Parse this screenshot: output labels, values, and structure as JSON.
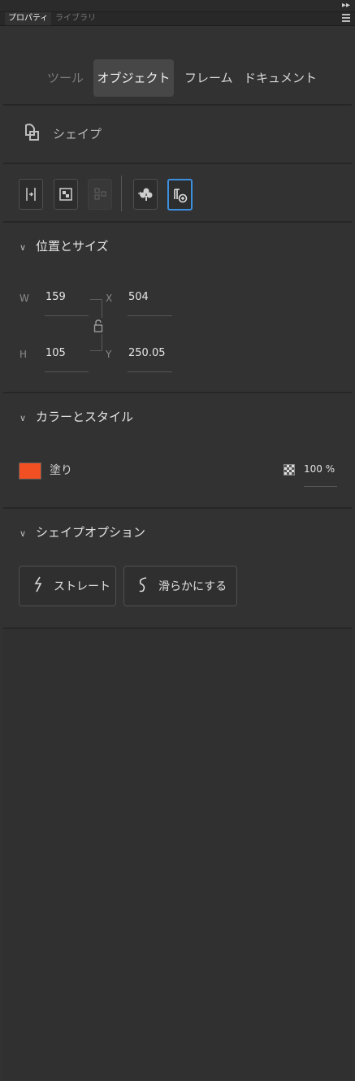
{
  "header": {
    "expand_icon": "double-chevron-right-icon",
    "menu_icon": "hamburger-icon"
  },
  "tabs": {
    "properties": "プロパティ",
    "library": "ライブラリ"
  },
  "modes": {
    "tool": "ツール",
    "object": "オブジェクト",
    "frame": "フレーム",
    "document": "ドキュメント"
  },
  "shape": {
    "label": "シェイプ"
  },
  "position_size": {
    "title": "位置とサイズ",
    "w_label": "W",
    "w_value": "159",
    "x_label": "X",
    "x_value": "504",
    "h_label": "H",
    "h_value": "105",
    "y_label": "Y",
    "y_value": "250.05"
  },
  "color_style": {
    "title": "カラーとスタイル",
    "fill_label": "塗り",
    "fill_color": "#f25022",
    "opacity": "100 %"
  },
  "shape_options": {
    "title": "シェイプオプション",
    "straight": "ストレート",
    "smooth": "滑らかにする"
  }
}
